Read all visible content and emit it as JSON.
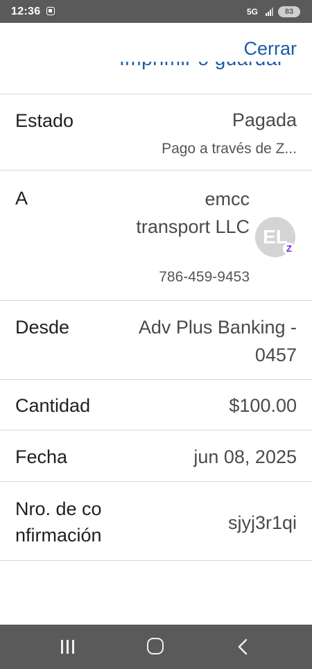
{
  "status_bar": {
    "time": "12:36",
    "network": "5G",
    "battery": "83",
    "screenshot_icon": "screenshot-icon",
    "signal_icon": "signal-icon"
  },
  "header": {
    "clipped_title": "Imprimir o guardar",
    "close_label": "Cerrar",
    "accent_color": "#1e5aa6"
  },
  "details": {
    "status": {
      "label": "Estado",
      "value": "Pagada",
      "subvalue": "Pago a través de Z..."
    },
    "to": {
      "label": "A",
      "name": "emcc transport LLC",
      "phone": "786-459-9453",
      "avatar_initials": "EL",
      "badge": "Z"
    },
    "from": {
      "label": "Desde",
      "value": "Adv Plus Banking - 0457"
    },
    "amount": {
      "label": "Cantidad",
      "value": "$100.00"
    },
    "date": {
      "label": "Fecha",
      "value": "jun 08, 2025"
    },
    "confirmation": {
      "label": "Nro. de co nfirmación",
      "value": "sjyj3r1qi"
    }
  },
  "nav_bar": {
    "recents_icon": "recents-icon",
    "home_icon": "home-icon",
    "back_icon": "back-icon"
  }
}
